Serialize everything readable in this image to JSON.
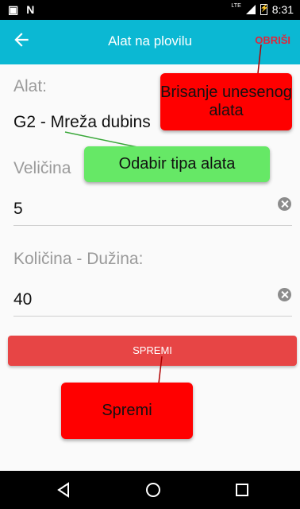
{
  "status_bar": {
    "left_icons": [
      "photo-icon",
      "n-icon"
    ],
    "network": "LTE",
    "time": "8:31"
  },
  "app_bar": {
    "title": "Alat na plovilu",
    "delete_label": "OBRIŠI",
    "delete_color": "#e0263a",
    "background": "#0bb8d3"
  },
  "form": {
    "tool_label": "Alat:",
    "tool_value": "G2 - Mreža dubins",
    "size_label": "Veličina",
    "size_value": "5",
    "quantity_label": "Količina - Dužina:",
    "quantity_value": "40"
  },
  "save_button": {
    "label": "SPREMI",
    "color": "#e74545"
  },
  "callouts": {
    "delete": "Brisanje unesenog alata",
    "tool_type": "Odabir tipa alata",
    "save": "Spremi"
  },
  "nav_bar": {
    "icons": [
      "back-triangle-icon",
      "home-circle-icon",
      "recents-square-icon"
    ]
  }
}
